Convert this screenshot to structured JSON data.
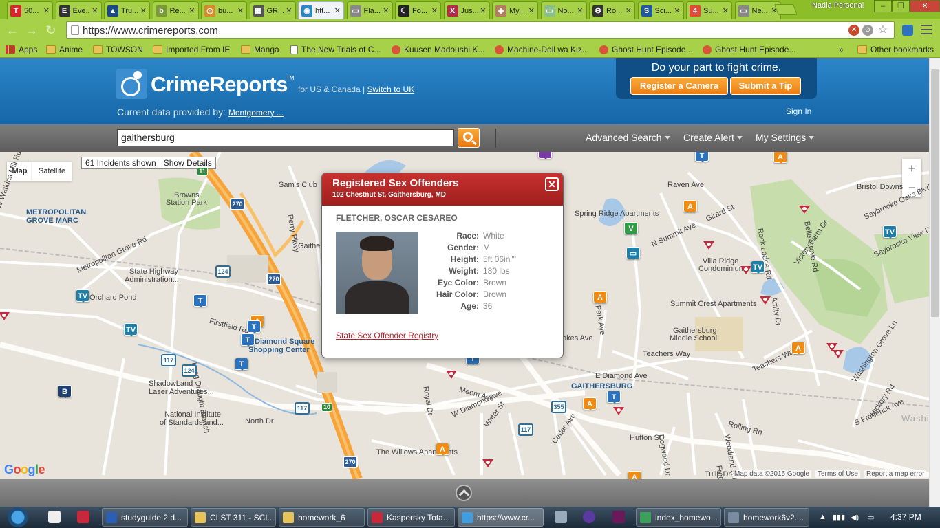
{
  "browser": {
    "tabs": [
      {
        "title": "50...",
        "icon": "T",
        "color": "#d9262d"
      },
      {
        "title": "Eve...",
        "icon": "E",
        "color": "#333333"
      },
      {
        "title": "Tru...",
        "icon": "▲",
        "color": "#1a4a86"
      },
      {
        "title": "Re...",
        "icon": "b",
        "color": "#7a9a3a"
      },
      {
        "title": "bu...",
        "icon": "◎",
        "color": "#d98a2a"
      },
      {
        "title": "GR...",
        "icon": "▦",
        "color": "#555555"
      },
      {
        "title": "htt...",
        "icon": "◉",
        "color": "#2b86c8",
        "active": true
      },
      {
        "title": "Fla...",
        "icon": "▭",
        "color": "#888888"
      },
      {
        "title": "Fo...",
        "icon": "☾",
        "color": "#222222"
      },
      {
        "title": "Jus...",
        "icon": "X",
        "color": "#b22d4a"
      },
      {
        "title": "My...",
        "icon": "◈",
        "color": "#b08060"
      },
      {
        "title": "No...",
        "icon": "▭",
        "color": "#8abf8a"
      },
      {
        "title": "Ro...",
        "icon": "⚙",
        "color": "#333333"
      },
      {
        "title": "Sci...",
        "icon": "S",
        "color": "#1f5aa0"
      },
      {
        "title": "Su...",
        "icon": "4",
        "color": "#e04a3a"
      },
      {
        "title": "Ne...",
        "icon": "▭",
        "color": "#888888"
      }
    ],
    "profile": "Nadia Personal",
    "url": "https://www.crimereports.com",
    "bookmarks": [
      {
        "label": "Apps",
        "icon": "apps"
      },
      {
        "label": "Anime",
        "icon": "folder"
      },
      {
        "label": "TOWSON",
        "icon": "folder"
      },
      {
        "label": "Imported From IE",
        "icon": "folder"
      },
      {
        "label": "Manga",
        "icon": "folder"
      },
      {
        "label": "The New Trials of C...",
        "icon": "page"
      },
      {
        "label": "Kuusen Madoushi K...",
        "icon": "round"
      },
      {
        "label": "Machine-Doll wa Kiz...",
        "icon": "round"
      },
      {
        "label": "Ghost Hunt Episode...",
        "icon": "round"
      },
      {
        "label": "Ghost Hunt Episode...",
        "icon": "round"
      }
    ],
    "bookmarks_overflow": "»",
    "other_bookmarks": "Other bookmarks"
  },
  "site": {
    "logo": "CrimeReports",
    "tm": "TM",
    "region_text": "for US & Canada |",
    "switch_link": "Switch to UK",
    "provided_by": "Current data provided by:",
    "provider": "Montgomery ...",
    "promo_text": "Do your part to fight crime.",
    "register_camera": "Register a Camera",
    "submit_tip": "Submit a Tip",
    "sign_in": "Sign In"
  },
  "search": {
    "value": "gaithersburg",
    "advanced": "Advanced Search",
    "create_alert": "Create Alert",
    "settings": "My Settings"
  },
  "map": {
    "type_map": "Map",
    "type_satellite": "Satellite",
    "incidents_shown": "61 Incidents shown",
    "show_details": "Show Details",
    "zoom_in": "+",
    "zoom_out": "−",
    "attribution_data": "Map data ©2015 Google",
    "terms": "Terms of Use",
    "report_error": "Report a map error",
    "google": "Google",
    "labels": [
      "Sam's Club",
      "Browns",
      "Station Park",
      "METROPOLITAN",
      "GROVE MARC",
      "W Watkins Mill Rd",
      "Metropolitan Grove Rd",
      "State Highway",
      "Administration...",
      "Orchard Pond",
      "Firstfield Rd",
      "Diamond Square",
      "Shopping Center",
      "Long Draught Branch",
      "ShadowLand",
      "Laser Adventures...",
      "National Institute",
      "of Standards and...",
      "North Dr",
      "The Willows Apartments",
      "Spring Ridge Apartments",
      "Raven Ave",
      "Girard St",
      "N Summit Ave",
      "Villa Ridge",
      "Condominiums",
      "Victory Farm Dr",
      "Summit Crest Apartments",
      "Gaithersburg",
      "Middle School",
      "Teachers Way",
      "E Diamond Ave",
      "GAITHERSBURG",
      "W Diamond Ave",
      "Meem Ave",
      "Rolling Rd",
      "Hutton St",
      "Cedar Ave",
      "Dogwood Dr",
      "Woodland Rd",
      "S Frederick Ave",
      "Bristol Downs",
      "Saybrooke Oaks Blvd",
      "Saybrooke View Dr",
      "Washington Grove Ln",
      "Hickory Rd",
      "Perry Pkwy",
      "Park Ave",
      "Water St",
      "Teachers Way",
      "Amity Dr",
      "Washington Grove",
      "Rock Lodge Rd",
      "Tulip Dr",
      "Frederick Ave",
      "Belle Grove Rd",
      "Gaithe",
      "okes Ave",
      "Royal Dr"
    ],
    "route_shields": [
      "270",
      "270",
      "124",
      "117",
      "124",
      "117",
      "355",
      "117",
      "270"
    ],
    "exit_shields": [
      "11",
      "10"
    ]
  },
  "popup": {
    "title": "Registered Sex Offenders",
    "address": "102 Chestnut St, Gaithersburg, MD",
    "name": "FLETCHER, OSCAR CESAREO",
    "fields": [
      {
        "label": "Race:",
        "value": "White"
      },
      {
        "label": "Gender:",
        "value": "M"
      },
      {
        "label": "Height:",
        "value": "5ft 06in\"\""
      },
      {
        "label": "Weight:",
        "value": "180 lbs"
      },
      {
        "label": "Eye Color:",
        "value": "Brown"
      },
      {
        "label": "Hair Color:",
        "value": "Brown"
      },
      {
        "label": "Age:",
        "value": "36"
      }
    ],
    "registry_link": "State Sex Offender Registry"
  },
  "taskbar": {
    "items": [
      {
        "label": "studyguide 2.d...",
        "color": "#2b5fb4"
      },
      {
        "label": "CLST 311 - SCI...",
        "color": "#e8c35a"
      },
      {
        "label": "homework_6",
        "color": "#e8c35a"
      },
      {
        "label": "Kaspersky Tota...",
        "color": "#c8283a"
      },
      {
        "label": "https://www.cr...",
        "color": "#3f9de0",
        "active": true
      },
      {
        "label": "index_homewo...",
        "color": "#3aa05a"
      },
      {
        "label": "homework6v2....",
        "color": "#7a8aa0"
      }
    ],
    "time": "4:37 PM"
  },
  "colors": {
    "header_blue": "#1a6fb0",
    "accent_orange": "#f08c14",
    "popup_red": "#b42a28",
    "chrome_green": "#a8d14a"
  }
}
